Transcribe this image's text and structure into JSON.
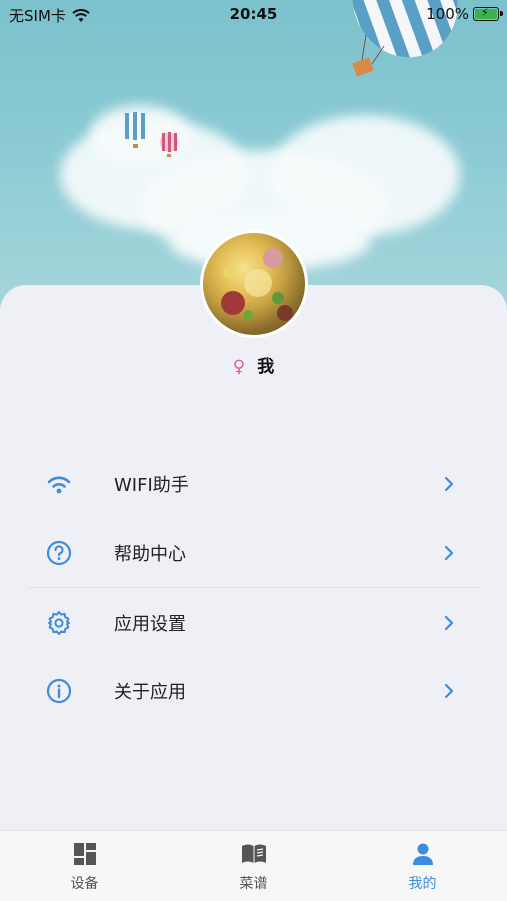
{
  "status_bar": {
    "carrier": "无SIM卡",
    "time": "20:45",
    "battery": "100%"
  },
  "profile": {
    "gender_symbol": "♀",
    "name": "我"
  },
  "menu": [
    {
      "label": "WIFI助手",
      "icon": "wifi-icon"
    },
    {
      "label": "帮助中心",
      "icon": "help-icon"
    },
    {
      "label": "应用设置",
      "icon": "gear-icon"
    },
    {
      "label": "关于应用",
      "icon": "info-icon"
    }
  ],
  "tabs": [
    {
      "label": "设备",
      "icon": "dashboard-icon",
      "active": false
    },
    {
      "label": "菜谱",
      "icon": "book-icon",
      "active": false
    },
    {
      "label": "我的",
      "icon": "person-icon",
      "active": true
    }
  ],
  "colors": {
    "accent": "#3e8cdb",
    "female": "#e05aa0",
    "sky": "#86c7d1"
  }
}
